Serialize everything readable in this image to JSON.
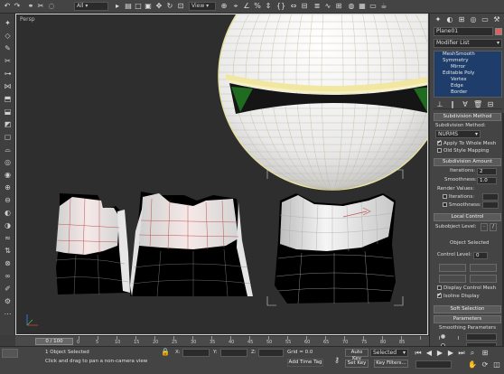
{
  "toolbar": {
    "filter_value": "All",
    "coord_system": "View",
    "icons": [
      "undo-icon",
      "redo-icon",
      "link-icon",
      "unlink-icon",
      "bind-icon",
      "select-icon",
      "select-by-name-icon",
      "region-select-icon",
      "window-crossing-icon",
      "move-icon",
      "rotate-icon",
      "scale-icon"
    ]
  },
  "viewport": {
    "label": "Persp"
  },
  "command_panel": {
    "object_name": "Plane01",
    "modifier_list_label": "Modifier List",
    "stack": [
      "MeshSmooth",
      "Symmetry",
      "Mirror",
      "Editable Poly",
      "Vertex",
      "Edge",
      "Border"
    ],
    "rollouts": {
      "subdivision_method": "Subdivision Method",
      "subdivision_amount": "Subdivision Amount",
      "local_control": "Local Control",
      "soft_selection": "Soft Selection",
      "parameters": "Parameters"
    },
    "subdivision_method_label": "Subdivision Method:",
    "subdivision_method_value": "NURMS",
    "apply_whole_mesh": "Apply To Whole Mesh",
    "old_style_mapping": "Old Style Mapping",
    "iterations_label": "Iterations:",
    "iterations_value": "2",
    "smoothness_label": "Smoothness:",
    "smoothness_value": "1.0",
    "render_values": "Render Values:",
    "subobject_level_label": "Subobject Level:",
    "object_selected": "Object Selected",
    "control_level_label": "Control Level:",
    "control_level_value": "0",
    "display_control_mesh": "Display Control Mesh",
    "isoline_display": "Isoline Display",
    "smoothing_parameters": "Smoothing Parameters"
  },
  "timeline": {
    "frame_label": "0 / 100",
    "ticks": [
      "0",
      "5",
      "10",
      "15",
      "20",
      "25",
      "30",
      "35",
      "40",
      "45",
      "50",
      "55",
      "60",
      "65",
      "70",
      "75",
      "80",
      "85",
      "90",
      "95",
      "100"
    ]
  },
  "status": {
    "selection_text": "1 Object Selected",
    "prompt_text": "Click and drag to pan a non-camera view",
    "x_label": "X:",
    "y_label": "Y:",
    "z_label": "Z:",
    "grid": "Grid = 0.0",
    "add_time_tag": "Add Time Tag",
    "auto_key": "Auto Key",
    "set_key": "Set Key",
    "selected_value": "Selected",
    "key_filters": "Key Filters..."
  },
  "colors": {
    "viewport_bg": "#2e2e2e",
    "selection_yellow": "#f0e8a8",
    "accent_green": "#1f6b1f",
    "edge_red": "#c0504d"
  }
}
